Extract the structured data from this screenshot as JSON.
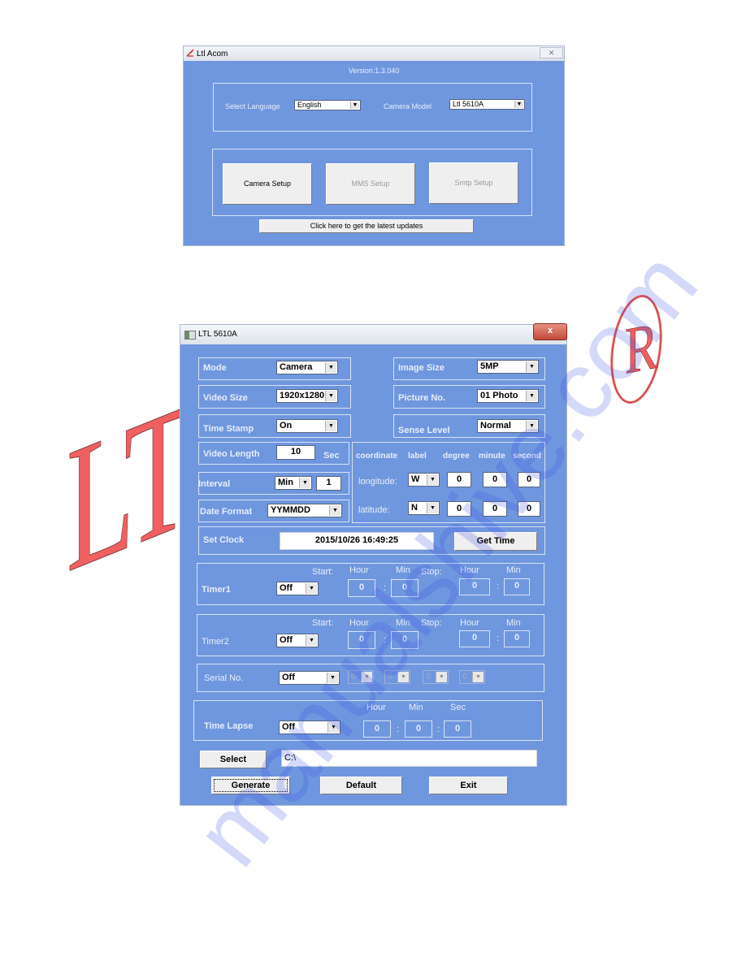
{
  "window1": {
    "title": "Ltl Acom",
    "close_glyph": "✕",
    "version": "Version:1.3.040",
    "language_label": "Select Language",
    "language_value": "English",
    "model_label": "Camera Model",
    "model_value": "Ltl 5610A",
    "buttons": {
      "camera_setup": "Camera Setup",
      "mms_setup": "MMS Setup",
      "smtp_setup": "Smtp Setup"
    },
    "updates_button": "Click here to get the latest updates"
  },
  "window2": {
    "title": "LTL 5610A",
    "close_glyph": "x",
    "mode": {
      "label": "Mode",
      "value": "Camera"
    },
    "video_size": {
      "label": "Video Size",
      "value": "1920x1280"
    },
    "time_stamp": {
      "label": "Time Stamp",
      "value": "On"
    },
    "video_length": {
      "label": "Video Length",
      "value": "10",
      "unit": "Sec"
    },
    "interval": {
      "label": "Interval",
      "unit_value": "Min",
      "value": "1"
    },
    "date_format": {
      "label": "Date Format",
      "value": "YYMMDD"
    },
    "image_size": {
      "label": "Image Size",
      "value": "5MP"
    },
    "picture_no": {
      "label": "Picture No.",
      "value": "01 Photo"
    },
    "sense_level": {
      "label": "Sense Level",
      "value": "Normal"
    },
    "coordinates": {
      "headers": [
        "coordinate",
        "label",
        "degree",
        "minute",
        "second"
      ],
      "longitude": {
        "label": "longitude:",
        "dir": "W",
        "degree": "0",
        "minute": "0",
        "second": "0"
      },
      "latitude": {
        "label": "latitude:",
        "dir": "N",
        "degree": "0",
        "minute": "0",
        "second": "0"
      }
    },
    "set_clock": {
      "label": "Set Clock",
      "value": "2015/10/26 16:49:25",
      "button": "Get Time"
    },
    "timer_headers": {
      "start": "Start:",
      "stop": "Stop:",
      "hour": "Hour",
      "min": "Min"
    },
    "timer1": {
      "label": "Timer1",
      "value": "Off",
      "start_hour": "0",
      "start_min": "0",
      "stop_hour": "0",
      "stop_min": "0"
    },
    "timer2": {
      "label": "Timer2",
      "value": "Off",
      "start_hour": "0",
      "start_min": "0",
      "stop_hour": "0",
      "stop_min": "0"
    },
    "serial_no": {
      "label": "Serial No.",
      "value": "Off",
      "digits": [
        "0",
        "0",
        "0",
        "0"
      ]
    },
    "time_lapse": {
      "label": "Time Lapse",
      "value": "Off",
      "headers": [
        "Hour",
        "Min",
        "Sec"
      ],
      "hour": "0",
      "min": "0",
      "sec": "0"
    },
    "path": {
      "button": "Select",
      "value": "C:\\"
    },
    "buttons": {
      "generate": "Generate",
      "default": "Default",
      "exit": "Exit"
    },
    "colon": ":"
  },
  "decorations": {
    "logo_letters": "LT",
    "registered_mark": "R",
    "watermark": "manualshive.com",
    "brand_red": "#f06060",
    "panel_blue": "#6f97df"
  }
}
